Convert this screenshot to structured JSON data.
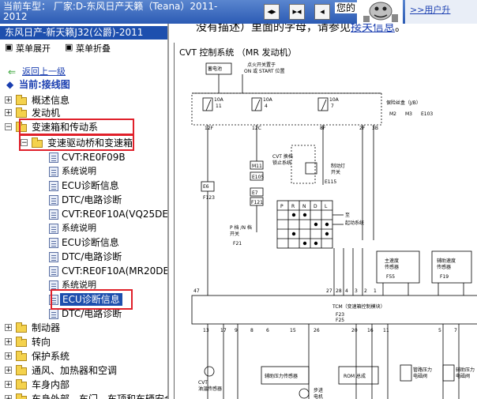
{
  "header": {
    "title": "当前车型： 厂家:D-东风日产天籁（Teana）2011-2012",
    "welcome": "您的",
    "user_center": ">>用户升"
  },
  "left": {
    "vehicle": "东风日产-新天籁J32(公爵)-2011",
    "expand": "菜单展开",
    "collapse": "菜单折叠",
    "back": "返回上一级",
    "current": "当前:接线图",
    "tree": [
      {
        "label": "概述信息"
      },
      {
        "label": "发动机"
      },
      {
        "label": "变速箱和传动系"
      },
      {
        "label": "变速驱动桥和变速箱"
      },
      {
        "label": "CVT:RE0F09B"
      },
      {
        "label": "系统说明"
      },
      {
        "label": "ECU诊断信息"
      },
      {
        "label": "DTC/电路诊断"
      },
      {
        "label": "CVT:RE0F10A(VQ25DE)"
      },
      {
        "label": "系统说明"
      },
      {
        "label": "ECU诊断信息"
      },
      {
        "label": "DTC/电路诊断"
      },
      {
        "label": "CVT:RE0F10A(MR20DE)"
      },
      {
        "label": "系统说明"
      },
      {
        "label": "ECU诊断信息"
      },
      {
        "label": "DTC/电路诊断"
      },
      {
        "label": "制动器"
      },
      {
        "label": "转向"
      },
      {
        "label": "保护系统"
      },
      {
        "label": "通风、加热器和空调"
      },
      {
        "label": "车身内部"
      },
      {
        "label": "车身外部、车门、车顶和车辆安全"
      }
    ]
  },
  "right": {
    "note_prefix": "没有描述）里面的字母，请参见",
    "note_link": "接关信息",
    "note_suffix": "。",
    "diagram": {
      "title": "CVT 控制系统 （MR 发动机）",
      "battery": "蓄电池",
      "ignition_1": "点火开关置于",
      "ignition_2": "ON 或 START 位置",
      "fuse1": "10A",
      "fuse1n": "11",
      "fuse2": "10A",
      "fuse2n": "4",
      "fuse3": "10A",
      "fuse3n": "7",
      "fuse_box": "保险丝盒（J/B）",
      "conn_m2": "M2",
      "conn_m3": "M3",
      "conn_e103": "E103",
      "p12f": "12F",
      "p12c": "12C",
      "p8f": "8F",
      "p2f": "2F",
      "p3b": "3B",
      "m11": "M11",
      "e105": "E105",
      "e7": "E7",
      "e6": "E6",
      "f123": "F123",
      "f121": "F121",
      "e115": "E115",
      "cvt_shift_1": "CVT 换档",
      "cvt_shift_2": "锁止系统",
      "brake_1": "制动灯",
      "brake_2": "开关",
      "to_1": "至",
      "to_2": "起动系统",
      "p_range_1": "P 档 /N 档",
      "p_range_2": "开关",
      "f21": "F21",
      "pos": [
        "P",
        "R",
        "N",
        "D",
        "L"
      ],
      "primary_1": "主速度",
      "primary_2": "传感器",
      "f55": "F55",
      "secondary_1": "辅助速度",
      "secondary_2": "传感器",
      "f19": "F19",
      "tcm": "TCM（变速箱控制模块）",
      "f23": "F23",
      "f25": "F25",
      "cvt_fluid_1": "CVT",
      "cvt_fluid_2": "油温传感器",
      "aux_pressure": "辅助压力传感器",
      "rom": "ROM 总成",
      "line_sol_1": "管路压力",
      "line_sol_2": "电磁阀",
      "sec_sol_1": "辅助压力",
      "sec_sol_2": "电磁阀",
      "step_1": "步进",
      "step_2": "电机",
      "pin47": "47",
      "pin27": "27",
      "pin28": "28",
      "pin4": "4",
      "pin3": "3",
      "pin2": "2",
      "pin1": "1",
      "pin13": "13",
      "pin17": "17",
      "pin9": "9",
      "pin8": "8",
      "pin6": "6",
      "pin15": "15",
      "pin26": "26",
      "pin20": "20",
      "pin16": "16",
      "pin11": "11",
      "pin5": "5",
      "pin7": "7"
    }
  }
}
